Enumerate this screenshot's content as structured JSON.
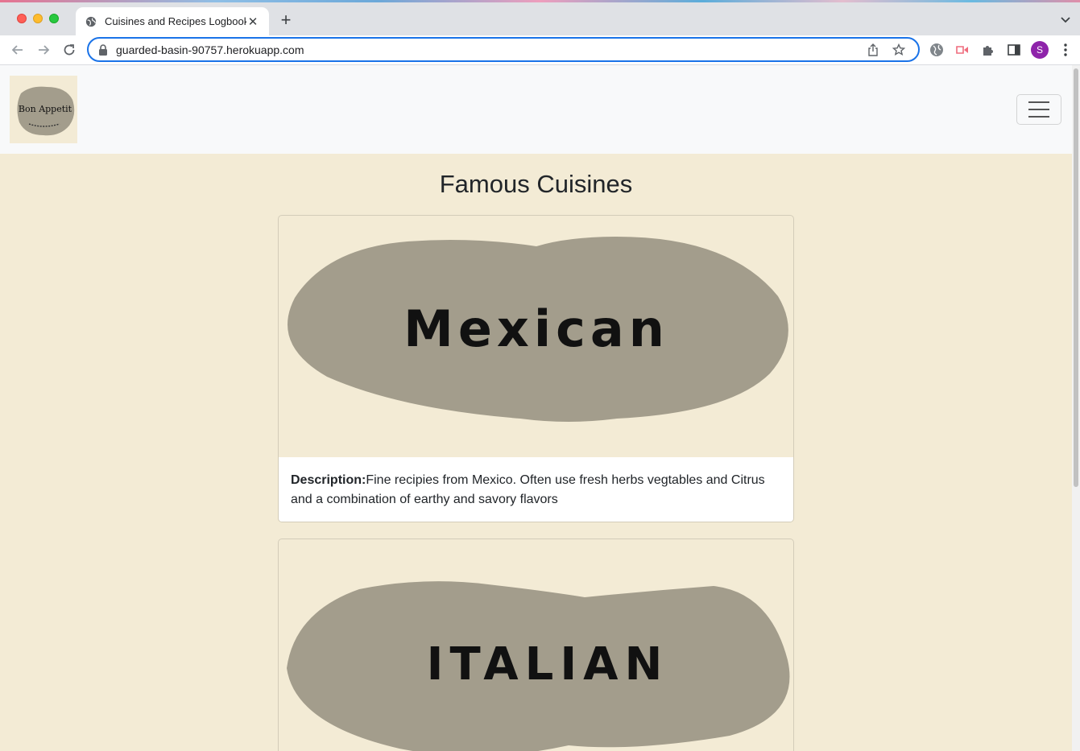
{
  "browser": {
    "tab_title": "Cuisines and Recipes Logbook",
    "url": "guarded-basin-90757.herokuapp.com",
    "profile_initial": "S"
  },
  "page": {
    "logo_text": "Bon Appetit",
    "heading": "Famous Cuisines",
    "cards": [
      {
        "image_text": "Mexican",
        "description_label": "Description:",
        "description": "Fine recipies from Mexico. Often use fresh herbs vegtables and Citrus and a combination of earthy and savory flavors"
      },
      {
        "image_text": "ITALIAN"
      }
    ]
  },
  "colors": {
    "page_bg": "#f3ebd5",
    "blob": "#a39d8c",
    "navbar_bg": "#f8f9fa"
  }
}
